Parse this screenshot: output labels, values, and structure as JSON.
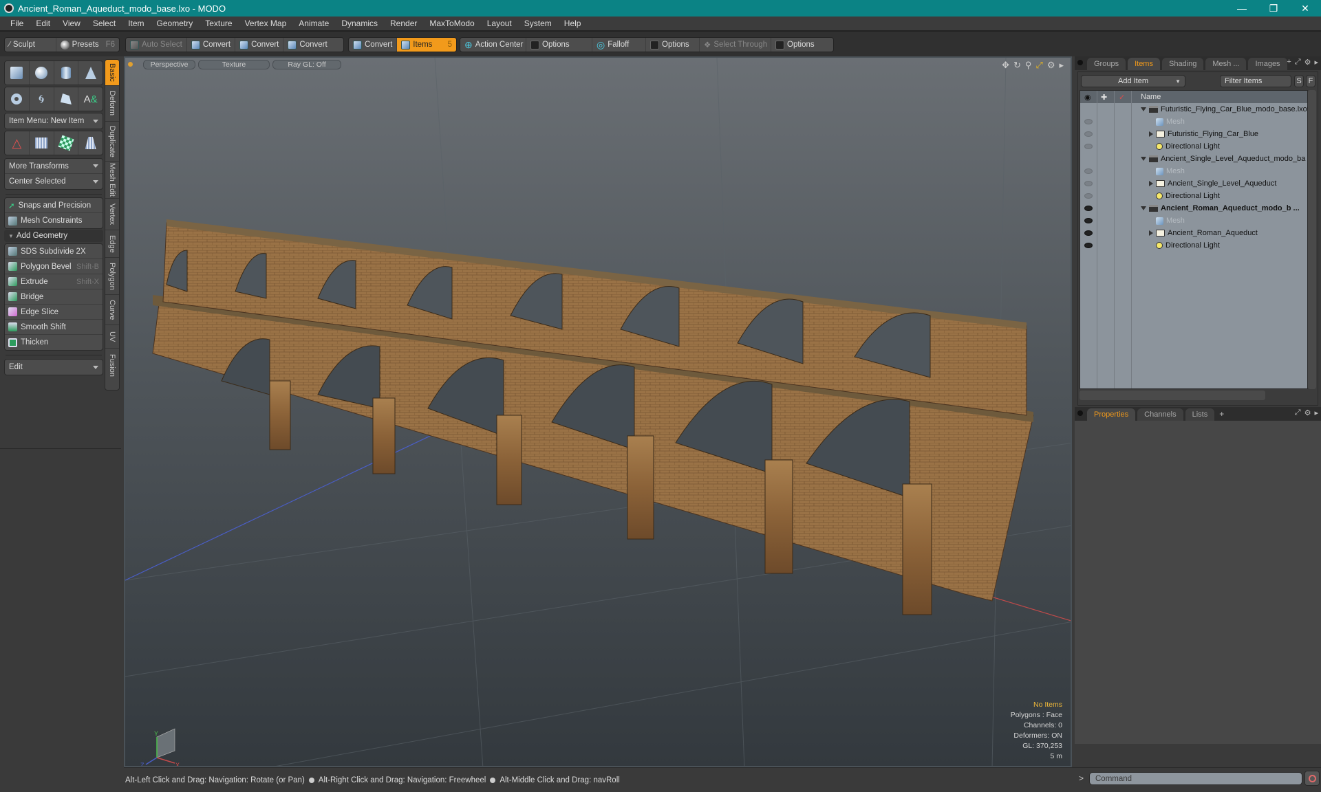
{
  "window": {
    "title": "Ancient_Roman_Aqueduct_modo_base.lxo - MODO",
    "controls": [
      "minimize",
      "restore",
      "close"
    ]
  },
  "menu": [
    "File",
    "Edit",
    "View",
    "Select",
    "Item",
    "Geometry",
    "Texture",
    "Vertex Map",
    "Animate",
    "Dynamics",
    "Render",
    "MaxToModo",
    "Layout",
    "System",
    "Help"
  ],
  "toolbar": {
    "sculpt": "Sculpt",
    "presets": "Presets",
    "presets_key": "F6",
    "auto_select": "Auto Select",
    "convert": "Convert",
    "items": "Items",
    "items_key": "5",
    "action_center": "Action Center",
    "options": "Options",
    "falloff": "Falloff",
    "select_through": "Select Through"
  },
  "left_panel": {
    "item_menu": "Item Menu: New Item",
    "more_transforms": "More Transforms",
    "center_selected": "Center Selected",
    "snaps": "Snaps and Precision",
    "mesh_constraints": "Mesh Constraints",
    "add_geometry": "Add Geometry",
    "geometry_tools": [
      {
        "label": "SDS Subdivide 2X",
        "shortcut": ""
      },
      {
        "label": "Polygon Bevel",
        "shortcut": "Shift-B"
      },
      {
        "label": "Extrude",
        "shortcut": "Shift-X"
      },
      {
        "label": "Bridge",
        "shortcut": ""
      },
      {
        "label": "Edge Slice",
        "shortcut": ""
      },
      {
        "label": "Smooth Shift",
        "shortcut": ""
      },
      {
        "label": "Thicken",
        "shortcut": ""
      }
    ],
    "edit_dropdown": "Edit",
    "vertical_tabs": [
      "Basic",
      "Deform",
      "Duplicate",
      "Mesh Edit",
      "Vertex",
      "Edge",
      "Polygon",
      "Curve",
      "UV",
      "Fusion"
    ],
    "active_tab": "Basic"
  },
  "viewport": {
    "view_mode": "Perspective",
    "shading": "Texture",
    "raygl": "Ray GL: Off",
    "info": {
      "selection": "No Items",
      "polygons": "Polygons : Face",
      "channels": "Channels: 0",
      "deformers": "Deformers: ON",
      "gl": "GL: 370,253",
      "scale": "5 m"
    },
    "axis_labels": {
      "x": "X",
      "y": "Y",
      "z": "Z"
    }
  },
  "right_panel": {
    "top_tabs": [
      "Groups",
      "Items",
      "Shading",
      "Mesh ...",
      "Images"
    ],
    "active_top_tab": "Items",
    "add_item": "Add Item",
    "filter_items": "Filter Items",
    "filter_s": "S",
    "filter_f": "F",
    "name_header": "Name",
    "items": [
      {
        "level": 0,
        "type": "scene",
        "label": "Futuristic_Flying_Car_Blue_modo_base.lxo*",
        "visible": false,
        "bold": false
      },
      {
        "level": 1,
        "type": "mesh",
        "label": "Mesh",
        "visible": false,
        "dim": true
      },
      {
        "level": 1,
        "type": "group",
        "label": "Futuristic_Flying_Car_Blue",
        "visible": false,
        "expandable": true
      },
      {
        "level": 1,
        "type": "light",
        "label": "Directional Light",
        "visible": false
      },
      {
        "level": 0,
        "type": "scene",
        "label": "Ancient_Single_Level_Aqueduct_modo_ba ...",
        "visible": false,
        "bold": false
      },
      {
        "level": 1,
        "type": "mesh",
        "label": "Mesh",
        "visible": false,
        "dim": true
      },
      {
        "level": 1,
        "type": "group",
        "label": "Ancient_Single_Level_Aqueduct",
        "visible": false,
        "expandable": true
      },
      {
        "level": 1,
        "type": "light",
        "label": "Directional Light",
        "visible": false
      },
      {
        "level": 0,
        "type": "scene",
        "label": "Ancient_Roman_Aqueduct_modo_b ...",
        "visible": true,
        "bold": true
      },
      {
        "level": 1,
        "type": "mesh",
        "label": "Mesh",
        "visible": true,
        "dim": true
      },
      {
        "level": 1,
        "type": "group",
        "label": "Ancient_Roman_Aqueduct",
        "visible": true,
        "expandable": true
      },
      {
        "level": 1,
        "type": "light",
        "label": "Directional Light",
        "visible": true
      }
    ],
    "bottom_tabs": [
      "Properties",
      "Channels",
      "Lists"
    ],
    "active_bottom_tab": "Properties",
    "command_placeholder": "Command",
    "command_prompt": ">"
  },
  "status_bar": {
    "hints": [
      "Alt-Left Click and Drag: Navigation: Rotate (or Pan)",
      "Alt-Right Click and Drag: Navigation: Freewheel",
      "Alt-Middle Click and Drag: navRoll"
    ]
  },
  "colors": {
    "accent": "#f29a1b",
    "title_bar": "#0b8385"
  }
}
